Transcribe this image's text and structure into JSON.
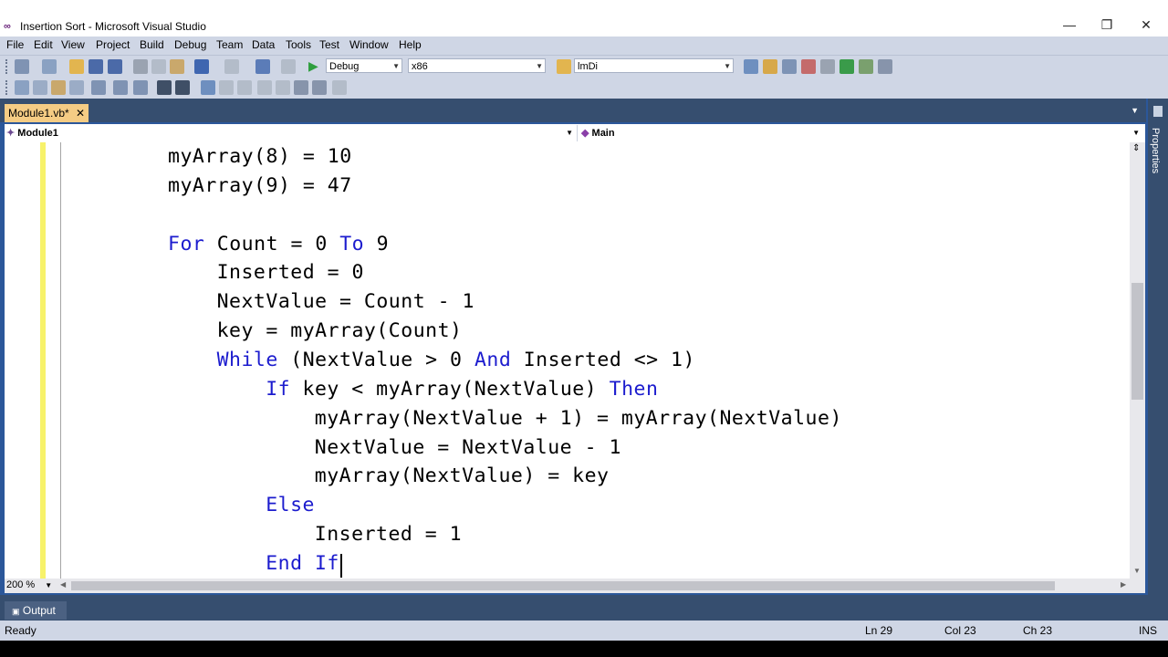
{
  "window": {
    "title": "Insertion Sort - Microsoft Visual Studio",
    "logo_icon": "infinity-icon",
    "minimize_glyph": "—",
    "restore_glyph": "❐",
    "close_glyph": "✕"
  },
  "menu": [
    "File",
    "Edit",
    "View",
    "Project",
    "Build",
    "Debug",
    "Team",
    "Data",
    "Tools",
    "Test",
    "Window",
    "Help"
  ],
  "toolbar": {
    "config_value": "Debug",
    "platform_value": "x86",
    "find_value": "lmDi"
  },
  "tab": {
    "label": "Module1.vb*",
    "close": "✕"
  },
  "nav": {
    "left": "Module1",
    "right": "Main"
  },
  "code": {
    "lines": [
      {
        "indent": 1,
        "parts": [
          {
            "t": "myArray(8) = 10"
          }
        ]
      },
      {
        "indent": 1,
        "parts": [
          {
            "t": "myArray(9) = 47"
          }
        ]
      },
      {
        "indent": 0,
        "parts": [
          {
            "t": ""
          }
        ]
      },
      {
        "indent": 1,
        "parts": [
          {
            "t": "For",
            "kw": true
          },
          {
            "t": " Count = 0 "
          },
          {
            "t": "To",
            "kw": true
          },
          {
            "t": " 9"
          }
        ]
      },
      {
        "indent": 2,
        "parts": [
          {
            "t": "Inserted = 0"
          }
        ]
      },
      {
        "indent": 2,
        "parts": [
          {
            "t": "NextValue = Count - 1"
          }
        ]
      },
      {
        "indent": 2,
        "parts": [
          {
            "t": "key = myArray(Count)"
          }
        ]
      },
      {
        "indent": 2,
        "parts": [
          {
            "t": "While",
            "kw": true
          },
          {
            "t": " (NextValue > 0 "
          },
          {
            "t": "And",
            "kw": true
          },
          {
            "t": " Inserted <> 1)"
          }
        ]
      },
      {
        "indent": 3,
        "parts": [
          {
            "t": "If",
            "kw": true
          },
          {
            "t": " key < myArray(NextValue) "
          },
          {
            "t": "Then",
            "kw": true
          }
        ]
      },
      {
        "indent": 4,
        "parts": [
          {
            "t": "myArray(NextValue + 1) = myArray(NextValue)"
          }
        ]
      },
      {
        "indent": 4,
        "parts": [
          {
            "t": "NextValue = NextValue - 1"
          }
        ]
      },
      {
        "indent": 4,
        "parts": [
          {
            "t": "myArray(NextValue) = key"
          }
        ]
      },
      {
        "indent": 3,
        "parts": [
          {
            "t": "Else",
            "kw": true
          }
        ]
      },
      {
        "indent": 4,
        "parts": [
          {
            "t": "Inserted = 1"
          }
        ]
      },
      {
        "indent": 3,
        "parts": [
          {
            "t": "End If",
            "kw": true
          }
        ]
      }
    ],
    "keyword_color": "#1c1cce"
  },
  "editor": {
    "zoom": "200 %"
  },
  "side_panel": {
    "label": "Properties"
  },
  "output_tab": {
    "label": "Output"
  },
  "status": {
    "text": "Ready",
    "line": "Ln 29",
    "col": "Col 23",
    "ch": "Ch 23",
    "mode": "INS"
  }
}
